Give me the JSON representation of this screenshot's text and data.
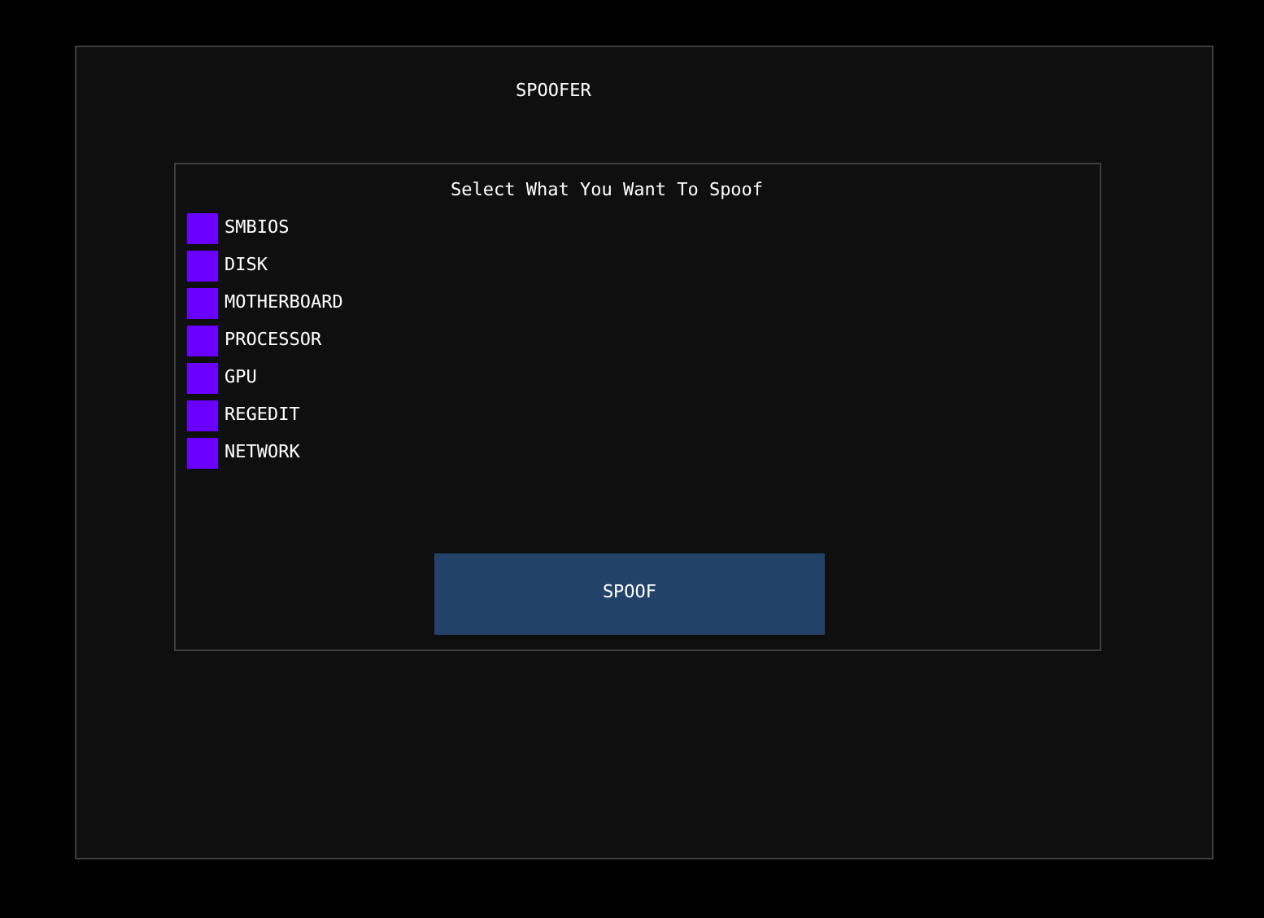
{
  "window": {
    "title": "SPOOFER"
  },
  "panel": {
    "heading": "Select What You Want To Spoof",
    "options": [
      {
        "label": "SMBIOS",
        "checked": false
      },
      {
        "label": "DISK",
        "checked": false
      },
      {
        "label": "MOTHERBOARD",
        "checked": false
      },
      {
        "label": "PROCESSOR",
        "checked": false
      },
      {
        "label": "GPU",
        "checked": false
      },
      {
        "label": "REGEDIT",
        "checked": false
      },
      {
        "label": "NETWORK",
        "checked": false
      }
    ],
    "button": "SPOOF"
  }
}
